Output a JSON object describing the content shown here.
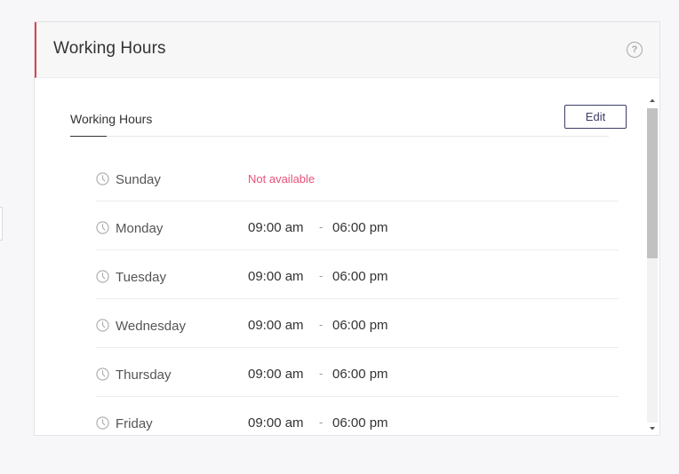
{
  "panel": {
    "title": "Working Hours",
    "help_icon": "question-circle-icon",
    "help_label": "?"
  },
  "tabs": [
    {
      "label": "Working Hours",
      "active": true
    }
  ],
  "edit_label": "Edit",
  "schedule": [
    {
      "day": "Sunday",
      "status": "Not available"
    },
    {
      "day": "Monday",
      "from": "09:00 am",
      "separator": "-",
      "to": "06:00 pm"
    },
    {
      "day": "Tuesday",
      "from": "09:00 am",
      "separator": "-",
      "to": "06:00 pm"
    },
    {
      "day": "Wednesday",
      "from": "09:00 am",
      "separator": "-",
      "to": "06:00 pm"
    },
    {
      "day": "Thursday",
      "from": "09:00 am",
      "separator": "-",
      "to": "06:00 pm"
    },
    {
      "day": "Friday",
      "from": "09:00 am",
      "separator": "-",
      "to": "06:00 pm"
    }
  ],
  "colors": {
    "accent": "#e0404c",
    "not_available": "#e8517a",
    "edit_border": "#3c3c6a"
  },
  "icons": {
    "day": "clock-icon",
    "scroll_up": "triangle-up-icon",
    "scroll_down": "triangle-down-icon"
  }
}
